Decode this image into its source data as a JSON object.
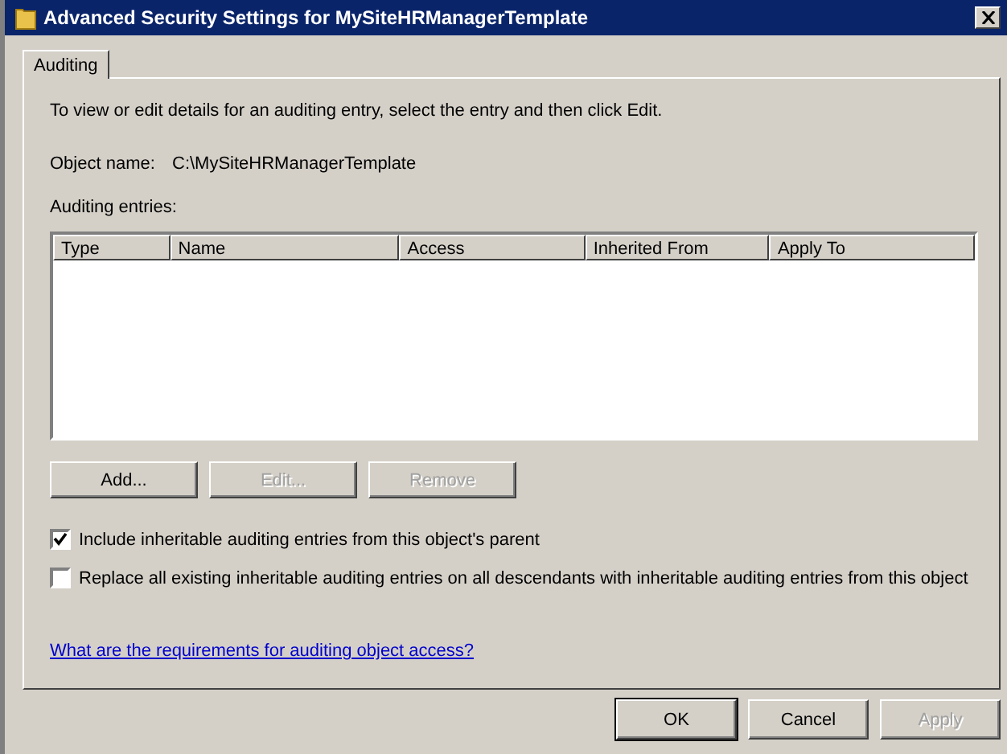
{
  "window": {
    "title": "Advanced Security Settings for MySiteHRManagerTemplate"
  },
  "tabs": [
    {
      "label": "Auditing",
      "selected": true
    }
  ],
  "instruction": "To view or edit details for an auditing entry, select the entry and then click Edit.",
  "object_name": {
    "label": "Object name:",
    "value": "C:\\MySiteHRManagerTemplate"
  },
  "entries": {
    "label": "Auditing entries:",
    "columns": [
      "Type",
      "Name",
      "Access",
      "Inherited From",
      "Apply To"
    ]
  },
  "entry_buttons": [
    {
      "label": "Add...",
      "disabled": false
    },
    {
      "label": "Edit...",
      "disabled": true
    },
    {
      "label": "Remove",
      "disabled": true
    }
  ],
  "options": [
    {
      "label": "Include inheritable auditing entries from this object's parent",
      "checked": true
    },
    {
      "label": "Replace all existing inheritable auditing entries on all descendants with inheritable auditing entries from this object",
      "checked": false
    }
  ],
  "help_link": "What are the requirements for auditing object access?",
  "buttons": [
    {
      "label": "OK",
      "disabled": false,
      "default": true
    },
    {
      "label": "Cancel",
      "disabled": false,
      "default": false
    },
    {
      "label": "Apply",
      "disabled": true,
      "default": false
    }
  ]
}
